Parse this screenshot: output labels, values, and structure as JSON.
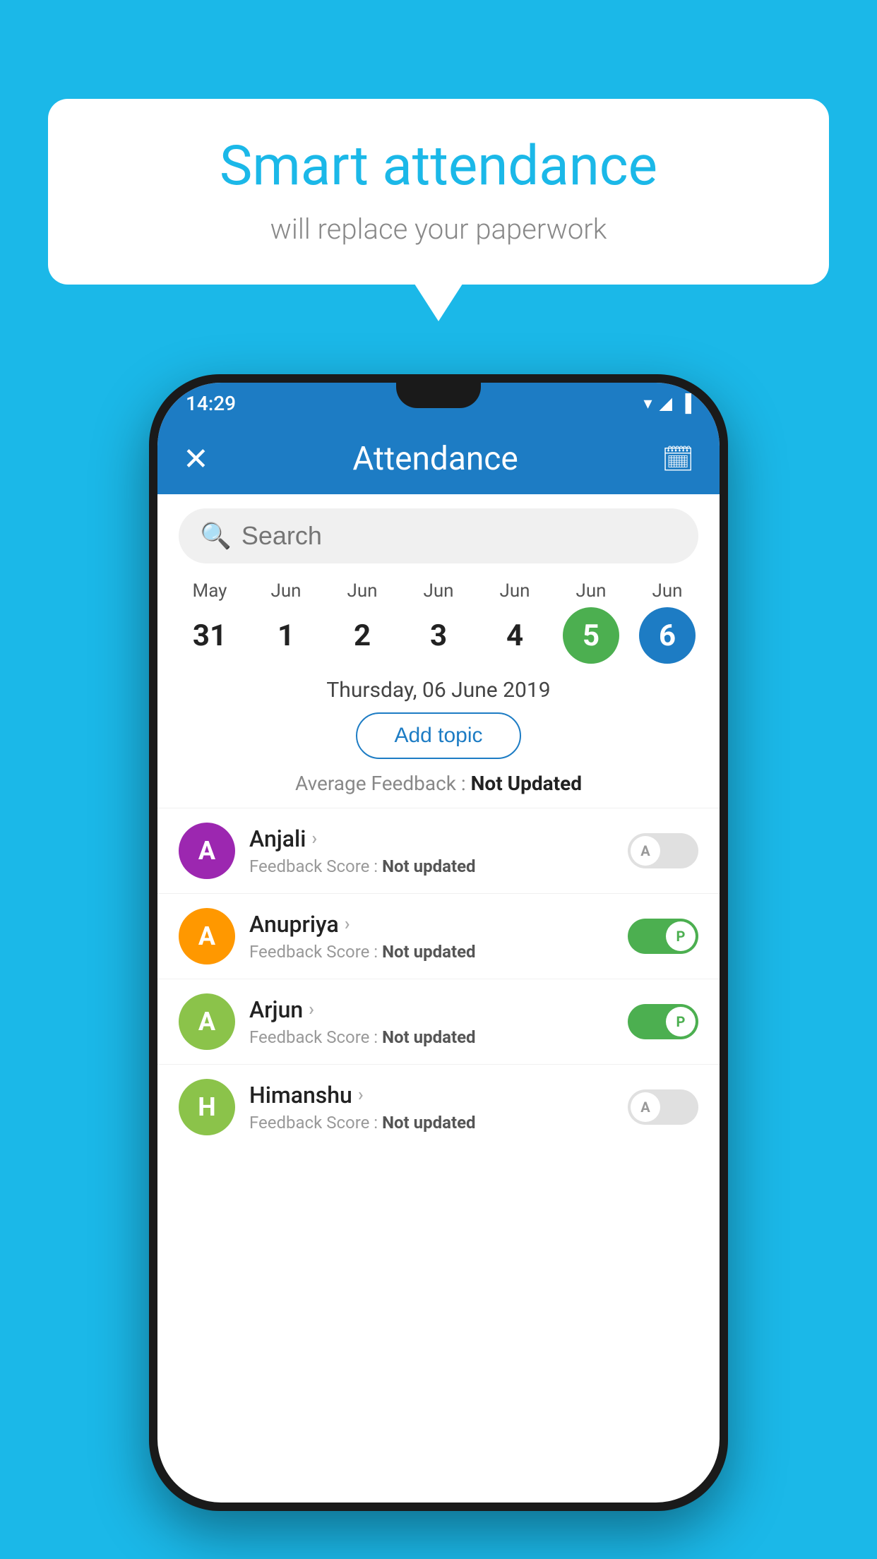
{
  "background_color": "#1bb8e8",
  "bubble": {
    "title": "Smart attendance",
    "subtitle": "will replace your paperwork"
  },
  "phone": {
    "status_bar": {
      "time": "14:29",
      "icons": "▼◀▐"
    },
    "app_bar": {
      "close_icon": "✕",
      "title": "Attendance",
      "calendar_icon": "📅"
    },
    "search": {
      "placeholder": "Search"
    },
    "calendar": {
      "days": [
        {
          "month": "May",
          "date": "31",
          "state": "normal"
        },
        {
          "month": "Jun",
          "date": "1",
          "state": "normal"
        },
        {
          "month": "Jun",
          "date": "2",
          "state": "normal"
        },
        {
          "month": "Jun",
          "date": "3",
          "state": "normal"
        },
        {
          "month": "Jun",
          "date": "4",
          "state": "normal"
        },
        {
          "month": "Jun",
          "date": "5",
          "state": "today"
        },
        {
          "month": "Jun",
          "date": "6",
          "state": "selected"
        }
      ]
    },
    "selected_date_label": "Thursday, 06 June 2019",
    "add_topic_label": "Add topic",
    "avg_feedback_label": "Average Feedback :",
    "avg_feedback_value": "Not Updated",
    "students": [
      {
        "name": "Anjali",
        "avatar_letter": "A",
        "avatar_color": "#9c27b0",
        "feedback_label": "Feedback Score :",
        "feedback_value": "Not updated",
        "attendance": "absent",
        "toggle_letter": "A"
      },
      {
        "name": "Anupriya",
        "avatar_letter": "A",
        "avatar_color": "#ff9800",
        "feedback_label": "Feedback Score :",
        "feedback_value": "Not updated",
        "attendance": "present",
        "toggle_letter": "P"
      },
      {
        "name": "Arjun",
        "avatar_letter": "A",
        "avatar_color": "#8bc34a",
        "feedback_label": "Feedback Score :",
        "feedback_value": "Not updated",
        "attendance": "present",
        "toggle_letter": "P"
      },
      {
        "name": "Himanshu",
        "avatar_letter": "H",
        "avatar_color": "#8bc34a",
        "feedback_label": "Feedback Score :",
        "feedback_value": "Not updated",
        "attendance": "absent",
        "toggle_letter": "A"
      }
    ]
  }
}
